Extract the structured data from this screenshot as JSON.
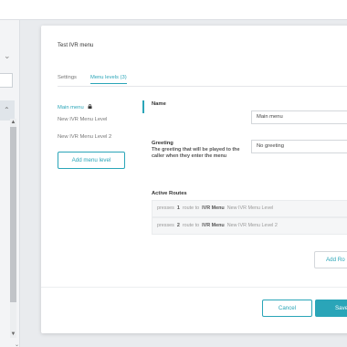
{
  "modal": {
    "title": "Test IVR menu",
    "tabs": [
      {
        "label": "Settings"
      },
      {
        "label": "Menu levels (3)"
      }
    ],
    "levels": [
      {
        "label": "Main menu"
      },
      {
        "label": "New IVR Menu Level"
      },
      {
        "label": "New IVR Menu Level 2"
      }
    ],
    "add_level_label": "Add menu level",
    "name_label": "Name",
    "name_value": "Main menu",
    "greeting_label": "Greeting",
    "greeting_description": "The greeting that will be played to the caller when they enter the menu",
    "greeting_value": "No greeting",
    "routes_label": "Active Routes",
    "routes": [
      {
        "presses": "presses",
        "key": "1",
        "route_to": "route to",
        "target": "IVR Menu",
        "level": "New IVR Menu Level"
      },
      {
        "presses": "presses",
        "key": "2",
        "route_to": "route to",
        "target": "IVR Menu",
        "level": "New IVR Menu Level 2"
      }
    ],
    "add_route_label": "Add Ro",
    "cancel_label": "Cancel",
    "save_label": "Save"
  },
  "colors": {
    "accent": "#2aa5b8"
  },
  "icons": {
    "lock": "lock-icon",
    "chevron": "chevron-down-icon"
  }
}
